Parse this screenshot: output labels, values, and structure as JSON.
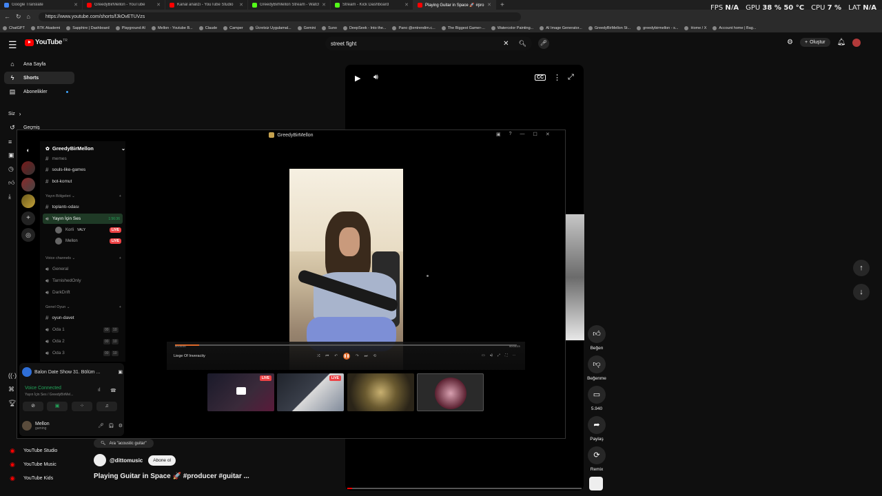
{
  "browser": {
    "tabs": [
      {
        "title": "Google Translate",
        "color": "#4285f4",
        "active": false
      },
      {
        "title": "GreedyBirMellon - YouTube",
        "color": "#ff0000",
        "active": false
      },
      {
        "title": "Kanal analizi - YouTube Studio",
        "color": "#ff0000",
        "active": false
      },
      {
        "title": "GreedyBirMellon Stream - Watch",
        "color": "#53fc18",
        "active": false
      },
      {
        "title": "Stream - Kick Dashboard",
        "color": "#53fc18",
        "active": false
      },
      {
        "title": "Playing Guitar in Space 🚀 #pro",
        "color": "#ff0000",
        "active": true
      }
    ],
    "new_tab": "+",
    "url": "https://www.youtube.com/shorts/fJkOvETUVzs",
    "bookmarks": [
      "ChatGPT",
      "BTK Akademi",
      "Sapphire | Dashboard",
      "Playground AI",
      "Mellon - Youtube B...",
      "Claude",
      "Camper",
      "Ücretsiz Uygulamal...",
      "Gemini",
      "Suno",
      "DeepSeek - Into the...",
      "Pano @entrendim.c...",
      "The Biggest Gamer-...",
      "Watercolor Painting...",
      "AI Image Generator...",
      "GreedyBirMellon St...",
      "greedybirmellon - s...",
      "Home / X",
      "Account home | Bag..."
    ]
  },
  "overlay_stats": {
    "fps_label": "FPS",
    "fps_value": "N/A",
    "gpu_label": "GPU",
    "gpu_value": "38 % 50 °C",
    "cpu_label": "CPU",
    "cpu_value": "7 %",
    "lat_label": "LAT",
    "lat_value": "N/A"
  },
  "youtube": {
    "logo": "YouTube",
    "logo_region": "TR",
    "search_value": "street fight",
    "create_label": "Oluştur",
    "sidebar": [
      {
        "label": "Ana Sayfa",
        "icon": "home-icon"
      },
      {
        "label": "Shorts",
        "icon": "shorts-icon"
      },
      {
        "label": "Abonelikler",
        "icon": "subscriptions-icon"
      }
    ],
    "you_label": "Siz",
    "history_label": "Geçmiş",
    "bottom_sidebar": [
      "YouTube Studio",
      "YouTube Music",
      "YouTube Kids"
    ],
    "actions": [
      {
        "label": "Beğen",
        "icon": "like-icon"
      },
      {
        "label": "Beğenme",
        "icon": "dislike-icon"
      },
      {
        "label": "5.940",
        "icon": "comments-icon"
      },
      {
        "label": "Paylaş",
        "icon": "share-icon"
      },
      {
        "label": "Remix",
        "icon": "remix-icon"
      }
    ],
    "suggestion": "Ara \"acoustic guitar\"",
    "channel": "@dittomusic",
    "subscribe_label": "Abone ol",
    "short_title": "Playing Guitar in Space 🚀 #producer #guitar ...",
    "progress": 0.02
  },
  "discord": {
    "window_title": "GreedyBirMellon",
    "server_name": "GreedyBirMellon",
    "channels_top": [
      "memes",
      "souls-like-games",
      "bot-komut"
    ],
    "category_broadcast": "Yayın Bölgeleri",
    "broadcast_text_channel": "toplantı-odası",
    "voice_channel_active": "Yayın İçin Ses",
    "voice_channel_time": "1:56:36",
    "voice_users": [
      {
        "name": "Korli",
        "tag": "VALY",
        "live": "LIVE"
      },
      {
        "name": "Mellon",
        "tag": "",
        "live": "LIVE"
      }
    ],
    "category_voice": "Voice channels",
    "voice_channels": [
      "General",
      "TarnishedOnly",
      "DarkDrift"
    ],
    "category_game": "Genel Oyun",
    "game_text_channel": "oyun-davet",
    "rooms": [
      {
        "name": "Oda 1",
        "count_a": "00",
        "count_b": "10"
      },
      {
        "name": "Oda 2",
        "count_a": "00",
        "count_b": "10"
      },
      {
        "name": "Oda 3",
        "count_a": "00",
        "count_b": "10"
      }
    ],
    "promo": "Balon Date Show 31. Bölüm ...",
    "voice_status": "Voice Connected",
    "voice_sub": "Yayın İçin Ses / GreedyBirMel...",
    "me_name": "Mellon",
    "me_status": "gaming",
    "stream": {
      "track_name": "Liege Of Inveracity",
      "time_left": "00:00:00",
      "time_right": "00:04:23",
      "progress": 0.07,
      "thumb_live_label": "LIVE"
    }
  }
}
